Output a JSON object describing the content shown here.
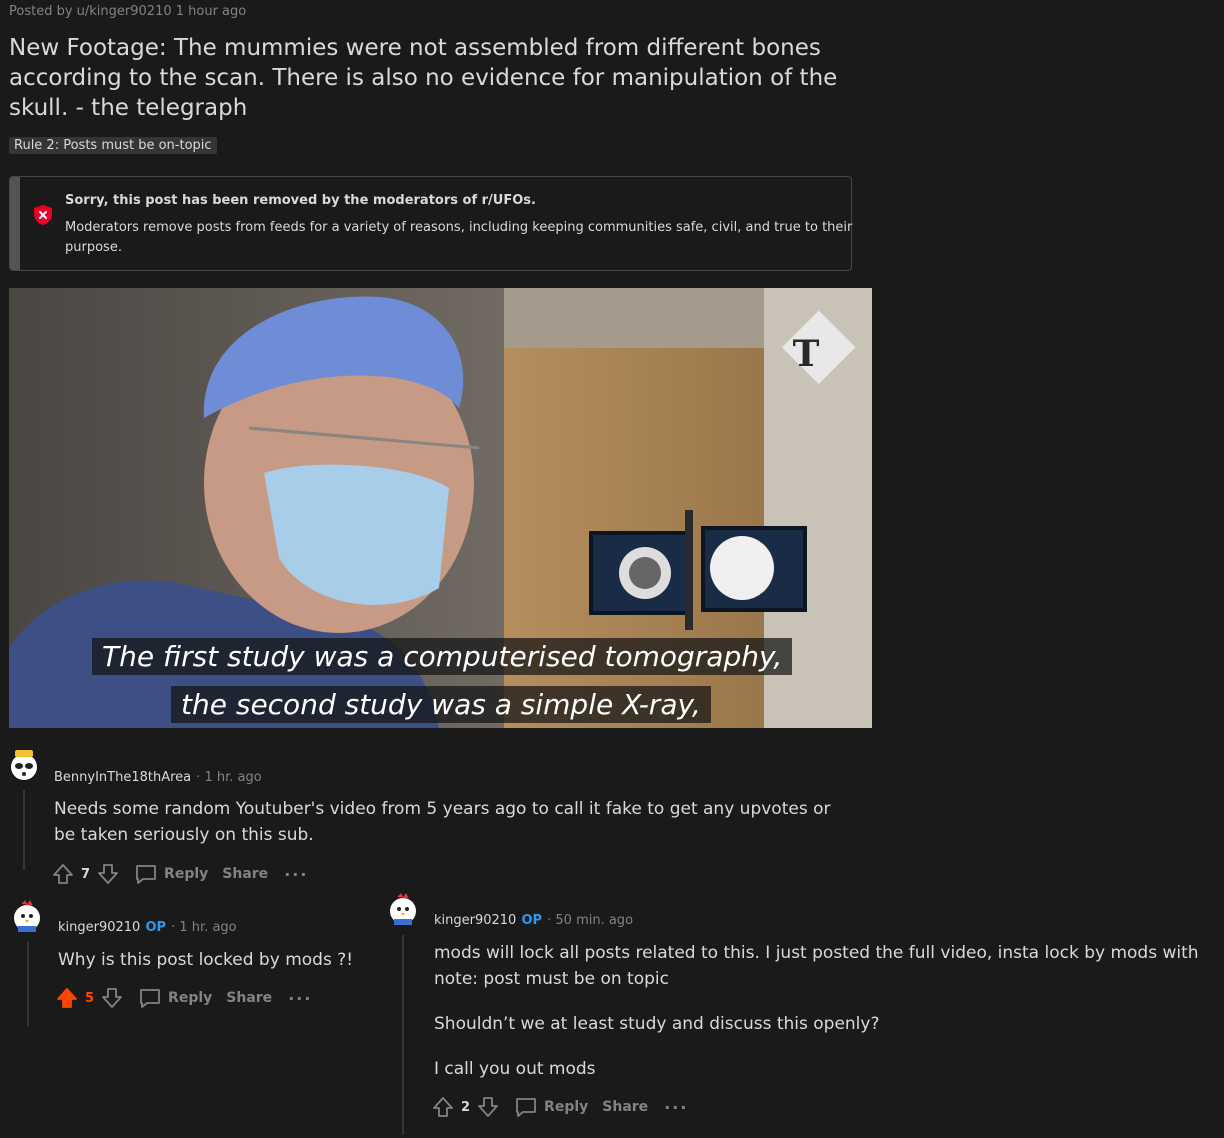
{
  "post": {
    "meta": "Posted by u/kinger90210 1 hour ago",
    "title": "New Footage: The mummies were not assembled from different bones according to the scan. There is also no evidence for manipulation of the skull. - the telegraph",
    "flair": "Rule 2: Posts must be on-topic"
  },
  "removed_notice": {
    "heading": "Sorry, this post has been removed by the moderators of r/UFOs.",
    "body": "Moderators remove posts from feeds for a variety of reasons, including keeping communities safe, civil, and true to their purpose."
  },
  "video": {
    "subtitle_line1": "The first study was a computerised tomography,",
    "subtitle_line2": "the second study was a simple X-ray,",
    "watermark_icon": "telegraph-logo-icon"
  },
  "comments": [
    {
      "username": "BennyInThe18thArea",
      "time": "1 hr. ago",
      "text": "Needs some random Youtuber's video from 5 years ago to call it fake to get any upvotes or be taken seriously on this sub.",
      "votes": "7",
      "reply_label": "Reply",
      "share_label": "Share"
    },
    {
      "username": "kinger90210",
      "op_label": "OP",
      "time": "1 hr. ago",
      "text": "Why is this post locked by mods ?!",
      "votes": "5",
      "reply_label": "Reply",
      "share_label": "Share",
      "upvoted": true,
      "upvote_color": "#ff4500"
    },
    {
      "username": "kinger90210",
      "op_label": "OP",
      "time": "50 min. ago",
      "paragraph1": "mods will lock all posts related to this. I just posted the full video, insta lock by mods with note: post must be on topic",
      "paragraph2": "Shouldn’t we at least study and discuss this openly?",
      "paragraph3": "I call you out mods",
      "votes": "2",
      "reply_label": "Reply",
      "share_label": "Share"
    }
  ],
  "colors": {
    "background": "#1a1a1b",
    "text": "#d7dadc",
    "muted": "#818384",
    "op_blue": "#2c98f0",
    "removed_red": "#ea0027"
  }
}
